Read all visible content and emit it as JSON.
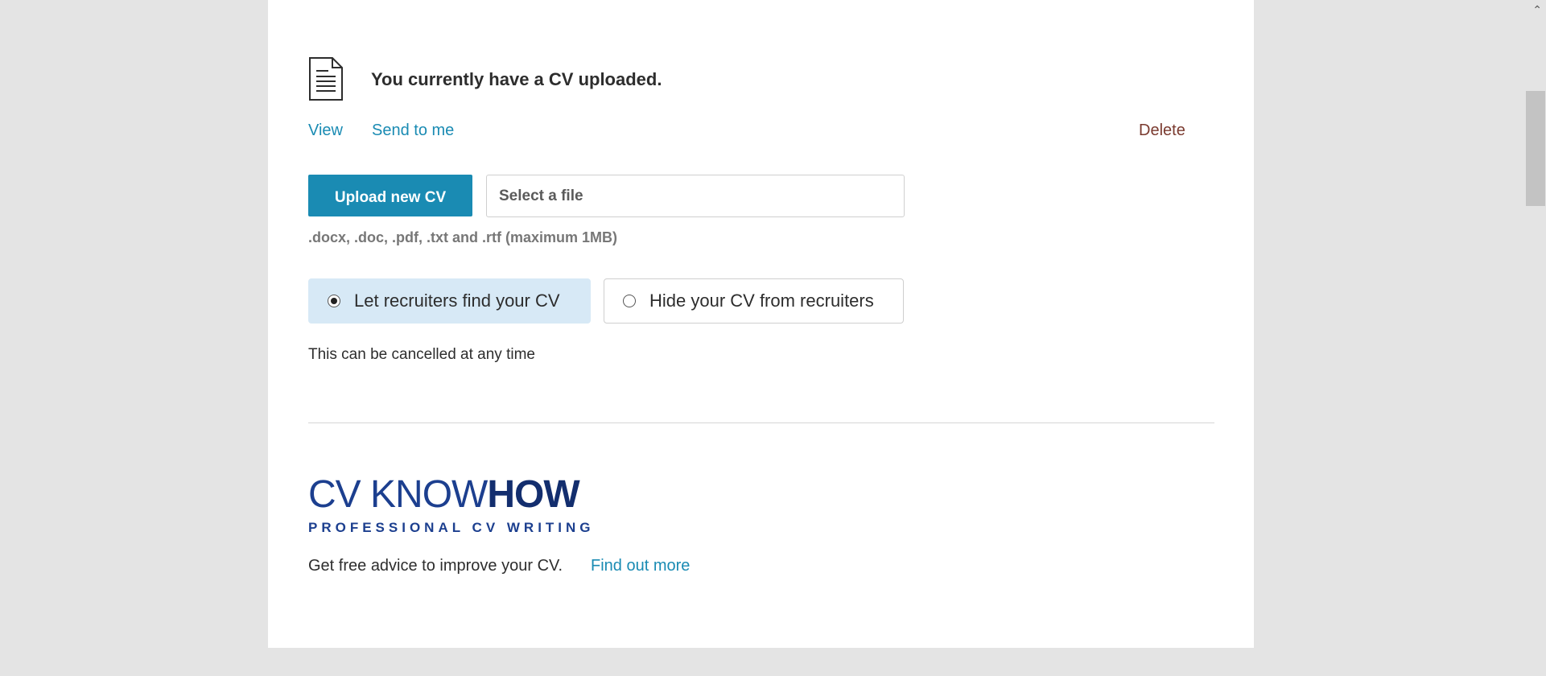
{
  "cv_status": {
    "icon": "document-icon",
    "message": "You currently have a CV uploaded.",
    "view_label": "View",
    "send_label": "Send to me",
    "delete_label": "Delete"
  },
  "upload": {
    "button_label": "Upload new CV",
    "file_placeholder": "Select a file",
    "hint": ".docx, .doc, .pdf, .txt and .rtf (maximum 1MB)"
  },
  "visibility": {
    "options": [
      {
        "label": "Let recruiters find your CV",
        "selected": true
      },
      {
        "label": "Hide your CV from recruiters",
        "selected": false
      }
    ],
    "note": "This can be cancelled at any time"
  },
  "promo": {
    "logo_light": "CV KNOW",
    "logo_bold": "HOW",
    "logo_tagline": "PROFESSIONAL CV WRITING",
    "text": "Get free advice to improve your CV.",
    "link_label": "Find out more"
  },
  "colors": {
    "accent": "#1a8bb3",
    "delete": "#7a3a2f",
    "selected_bg": "#d7e9f6",
    "logo": "#1c3f8f",
    "page_bg": "#e4e4e4"
  }
}
